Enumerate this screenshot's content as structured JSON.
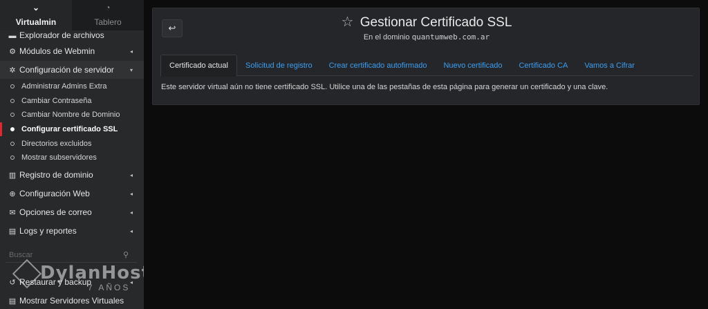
{
  "sidebar": {
    "tabs": [
      {
        "label": "Virtualmin",
        "icon": "chevron-down-icon",
        "glyph": "⌄"
      },
      {
        "label": "Tablero",
        "icon": "dashboard-icon",
        "glyph": "◔"
      }
    ],
    "items": [
      {
        "label": "Explorador de archivos",
        "icon": "folder-icon",
        "glyph": "▬"
      },
      {
        "label": "Módulos de Webmin",
        "icon": "cogs-icon",
        "glyph": "⚙",
        "caret": "◂"
      },
      {
        "label": "Configuración de servidor",
        "icon": "gears-icon",
        "glyph": "✲",
        "caret": "▾"
      }
    ],
    "subitems": [
      {
        "label": "Administrar Admins Extra"
      },
      {
        "label": "Cambiar Contraseña"
      },
      {
        "label": "Cambiar Nombre de Dominio"
      },
      {
        "label": "Configurar certificado SSL"
      },
      {
        "label": "Directorios excluidos"
      },
      {
        "label": "Mostrar subservidores"
      }
    ],
    "items2": [
      {
        "label": "Registro de dominio",
        "icon": "server-icon",
        "glyph": "▥",
        "caret": "◂"
      },
      {
        "label": "Configuración Web",
        "icon": "globe-icon",
        "glyph": "⊕",
        "caret": "◂"
      },
      {
        "label": "Opciones de correo",
        "icon": "envelope-icon",
        "glyph": "✉",
        "caret": "◂"
      },
      {
        "label": "Logs y reportes",
        "icon": "file-icon",
        "glyph": "▤",
        "caret": "◂"
      }
    ],
    "search_placeholder": "Buscar",
    "search_glyph": "⚲",
    "items3": [
      {
        "label": "Restaurar y backup",
        "icon": "history-icon",
        "glyph": "↺",
        "caret": "◂"
      },
      {
        "label": "Mostrar Servidores Virtuales",
        "icon": "list-icon",
        "glyph": "▤"
      }
    ]
  },
  "watermark": {
    "brand": "DylanHost",
    "years": "7 AÑOS"
  },
  "main": {
    "back_glyph": "↩",
    "star_glyph": "☆",
    "title": "Gestionar Certificado SSL",
    "subtitle_prefix": "En el dominio",
    "domain": "quantumweb.com.ar",
    "tabs": [
      {
        "label": "Certificado actual"
      },
      {
        "label": "Solicitud de registro"
      },
      {
        "label": "Crear certificado autofirmado"
      },
      {
        "label": "Nuevo certificado"
      },
      {
        "label": "Certificado CA"
      },
      {
        "label": "Vamos a Cifrar"
      }
    ],
    "message": "Este servidor virtual aún no tiene certificado SSL. Utilice una de las pestañas de esta página para generar un certificado y una clave."
  },
  "colors": {
    "accent": "#3d9ff3",
    "active_marker": "#e0262e",
    "sidebar_bg": "#27292b",
    "panel_bg": "#242629"
  }
}
